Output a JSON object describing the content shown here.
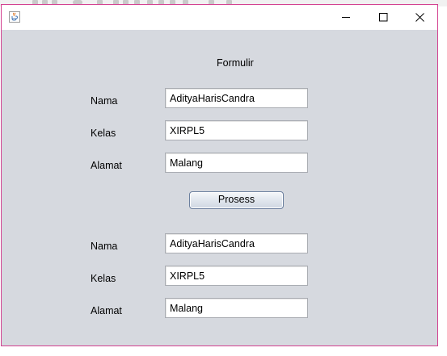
{
  "window": {
    "icon": "java-cup-icon",
    "controls": {
      "minimize": "minimize-icon",
      "maximize": "maximize-icon",
      "close": "close-icon"
    }
  },
  "form": {
    "title": "Formulir",
    "input_section": {
      "nama_label": "Nama",
      "nama_value": "AdityaHarisCandra",
      "kelas_label": "Kelas",
      "kelas_value": "XIRPL5",
      "alamat_label": "Alamat",
      "alamat_value": "Malang"
    },
    "process_button": "Prosess",
    "output_section": {
      "nama_label": "Nama",
      "nama_value": "AdityaHarisCandra",
      "kelas_label": "Kelas",
      "kelas_value": "XIRPL5",
      "alamat_label": "Alamat",
      "alamat_value": "Malang"
    }
  },
  "colors": {
    "window_border": "#d33f8f",
    "content_background": "#d6d9df",
    "titlebar_background": "#ffffff"
  }
}
